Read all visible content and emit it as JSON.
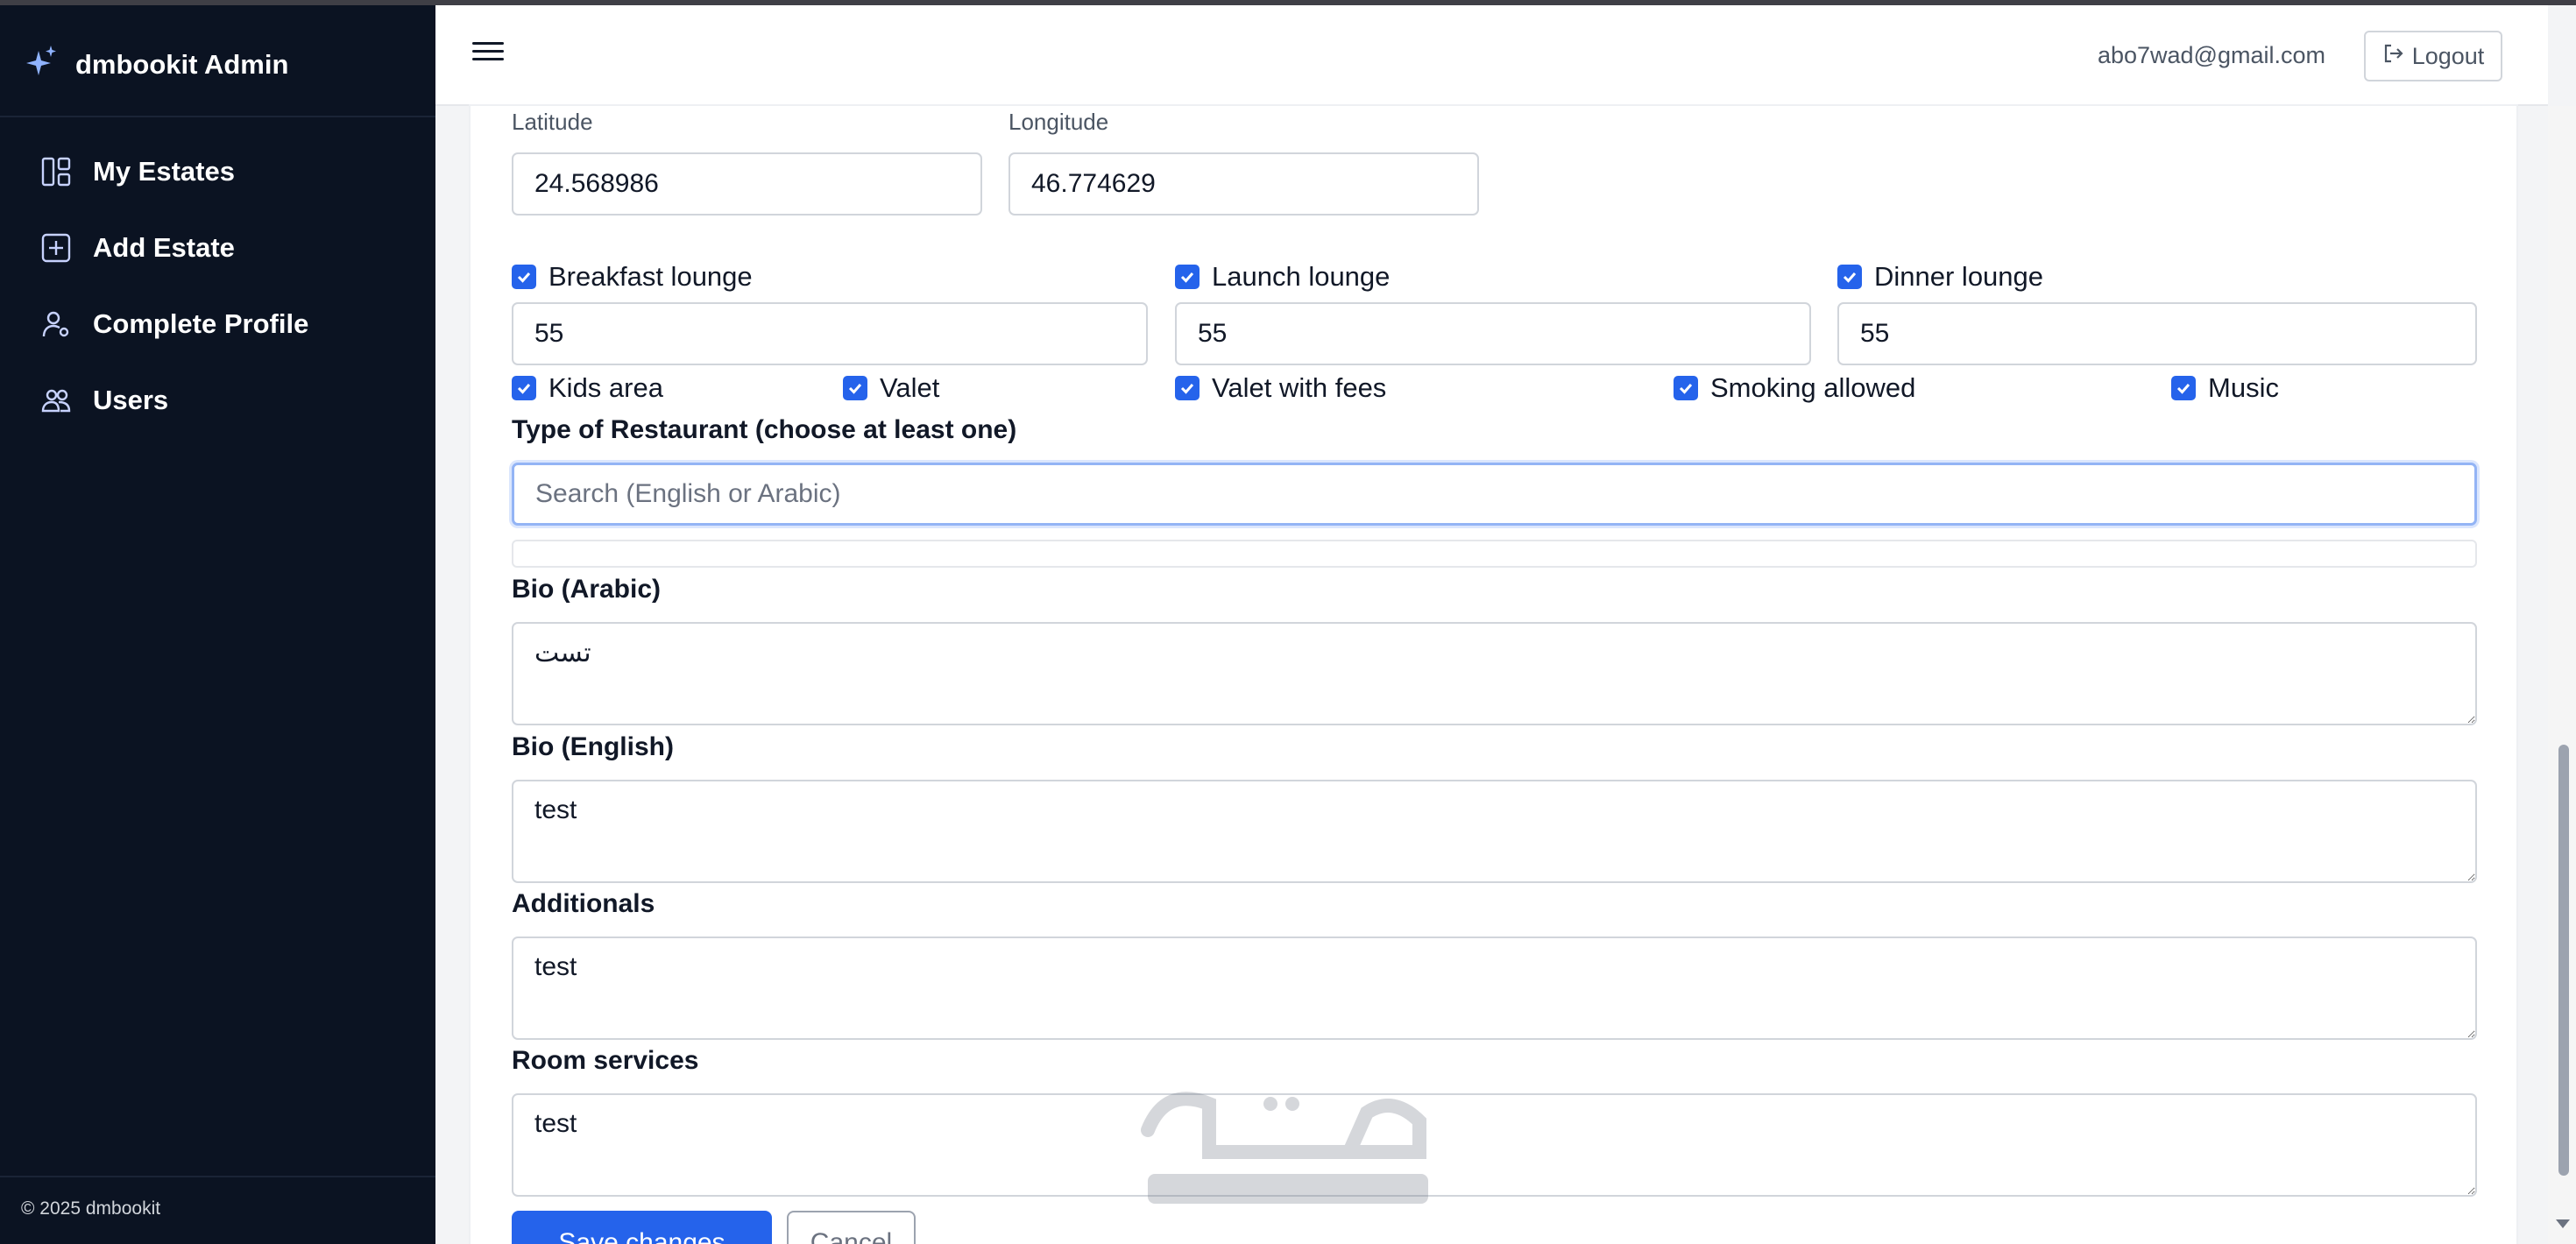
{
  "app": {
    "title": "dmbookit Admin",
    "footer": "© 2025 dmbookit"
  },
  "sidebar": {
    "items": [
      {
        "label": "My Estates",
        "icon": "layout-icon"
      },
      {
        "label": "Add Estate",
        "icon": "plus-square-icon"
      },
      {
        "label": "Complete Profile",
        "icon": "user-gear-icon"
      },
      {
        "label": "Users",
        "icon": "users-icon"
      }
    ]
  },
  "header": {
    "email": "abo7wad@gmail.com",
    "logout_label": "Logout"
  },
  "form": {
    "latitude": {
      "label": "Latitude",
      "value": "24.568986"
    },
    "longitude": {
      "label": "Longitude",
      "value": "46.774629"
    },
    "lounges": [
      {
        "label": "Breakfast lounge",
        "checked": true,
        "value": "55"
      },
      {
        "label": "Launch lounge",
        "checked": true,
        "value": "55"
      },
      {
        "label": "Dinner lounge",
        "checked": true,
        "value": "55"
      }
    ],
    "amenities": [
      {
        "label": "Kids area",
        "checked": true
      },
      {
        "label": "Valet",
        "checked": true
      },
      {
        "label": "Valet with fees",
        "checked": true
      },
      {
        "label": "Smoking allowed",
        "checked": true
      },
      {
        "label": "Music",
        "checked": true
      }
    ],
    "restaurant_type": {
      "label": "Type of Restaurant (choose at least one)",
      "placeholder": "Search (English or Arabic)"
    },
    "bio_ar": {
      "label": "Bio (Arabic)",
      "value": "تست"
    },
    "bio_en": {
      "label": "Bio (English)",
      "value": "test"
    },
    "additionals": {
      "label": "Additionals",
      "value": "test"
    },
    "room_services": {
      "label": "Room services",
      "value": "test"
    },
    "save_label": "Save changes",
    "cancel_label": "Cancel"
  },
  "colors": {
    "sidebar_bg": "#0b1322",
    "primary": "#2563eb",
    "page_bg": "#f3f4f6"
  }
}
